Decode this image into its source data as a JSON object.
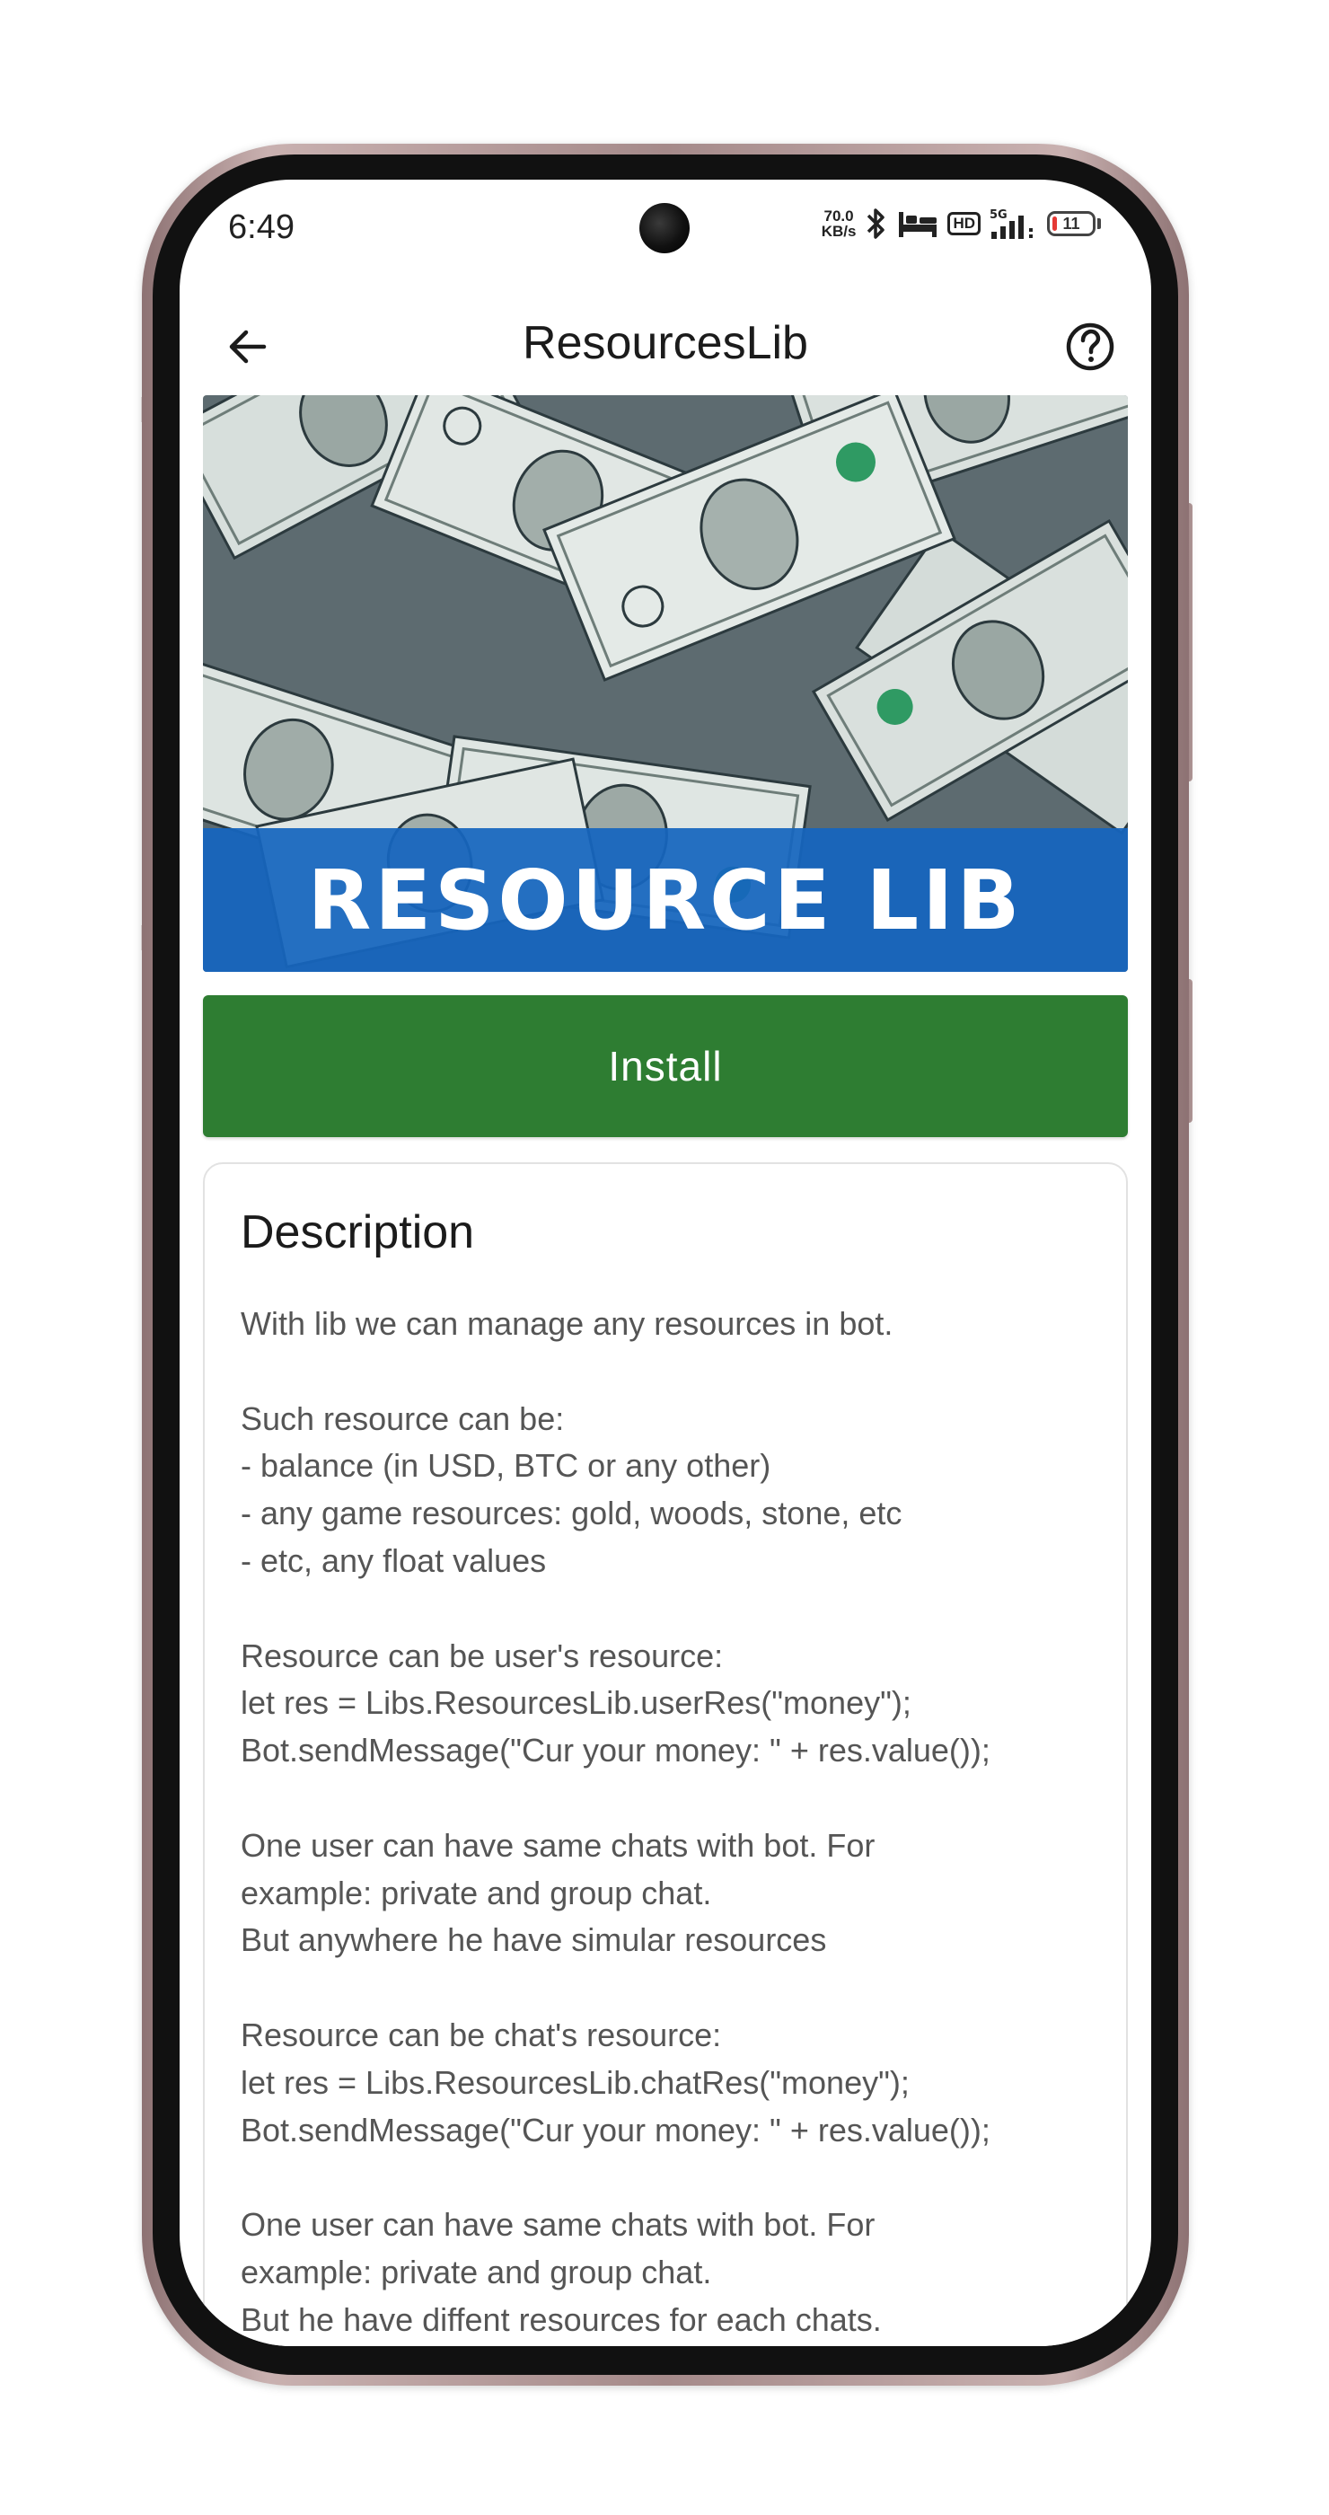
{
  "status_bar": {
    "time": "6:49",
    "net_speed_value": "70.0",
    "net_speed_unit": "KB/s",
    "hd_label": "HD",
    "network_label": "5G",
    "battery_level": "11",
    "battery_fraction": 0.11,
    "icons": [
      "bluetooth-icon",
      "sleep-mode-icon",
      "hd-icon",
      "signal-icon",
      "battery-icon"
    ]
  },
  "app_bar": {
    "title": "ResourcesLib",
    "back_icon": "arrow-left-icon",
    "help_icon": "question-circle-icon"
  },
  "banner": {
    "caption": "RESOURCE LIB"
  },
  "install": {
    "label": "Install",
    "color": "#2e7d32"
  },
  "description": {
    "title": "Description",
    "lines": [
      "With lib we can manage any resources in bot.",
      "",
      "Such resource can be:",
      "- balance (in USD, BTC or any other)",
      "- any game resources: gold, woods, stone, etc",
      "- etc, any float values",
      "",
      "Resource can be user's resource:",
      "let res = Libs.ResourcesLib.userRes(\"money\");",
      "Bot.sendMessage(\"Cur your money: \" + res.value());",
      "",
      "One user can have same chats with bot. For",
      "example: private and group chat.",
      "But anywhere he have simular resources",
      "",
      "Resource can be chat's resource:",
      "let res = Libs.ResourcesLib.chatRes(\"money\");",
      "Bot.sendMessage(\"Cur your money: \" + res.value());",
      "",
      "One user can have same chats with bot. For",
      "example: private and group chat.",
      "But he have diffent resources for each chats."
    ]
  },
  "colors": {
    "banner_blue": "#1665be",
    "install_green": "#2e7d32",
    "battery_low": "#e53935"
  }
}
